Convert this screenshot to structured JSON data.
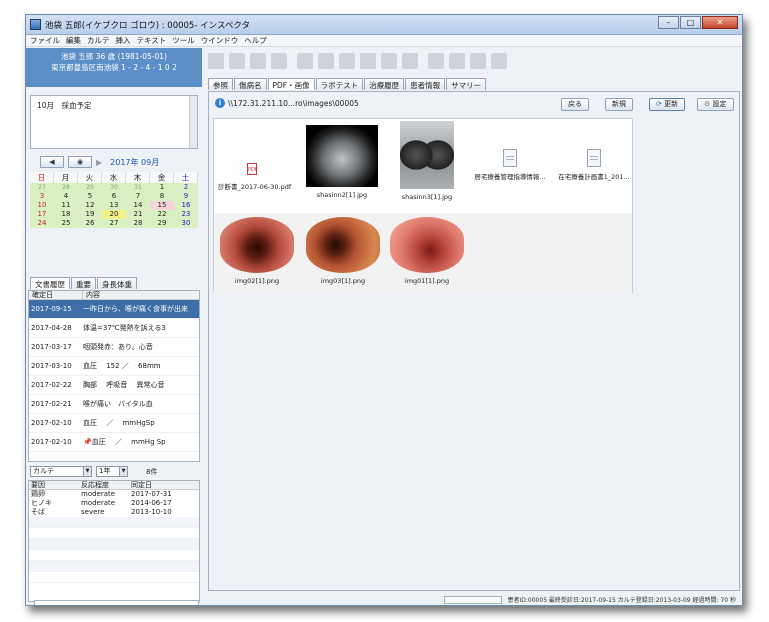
{
  "window": {
    "title": "池袋 五郎(イケブクロ ゴロウ) : 00005- インスペクタ"
  },
  "menu": [
    "ファイル",
    "編集",
    "カルテ",
    "挿入",
    "テキスト",
    "ツール",
    "ウインドウ",
    "ヘルプ"
  ],
  "patient": {
    "name_line": "池袋 五郎 36 歳 (1981-05-01)",
    "address": "東京都豊島区南池袋 1 - 2 - 4 - 1 0 2"
  },
  "memo": "10月　採血予定",
  "calendar": {
    "prev": "◀",
    "today_btn": "◉",
    "next": "▶",
    "year_month": "2017年 09月",
    "headers": [
      "日",
      "月",
      "火",
      "水",
      "木",
      "金",
      "土"
    ],
    "rows": [
      [
        "27",
        "28",
        "29",
        "30",
        "31",
        "1",
        "2"
      ],
      [
        "3",
        "4",
        "5",
        "6",
        "7",
        "8",
        "9"
      ],
      [
        "10",
        "11",
        "12",
        "13",
        "14",
        "15",
        "16"
      ],
      [
        "17",
        "18",
        "19",
        "20",
        "21",
        "22",
        "23"
      ],
      [
        "24",
        "25",
        "26",
        "27",
        "28",
        "29",
        "30"
      ]
    ]
  },
  "left_tabs": [
    "文書履歴",
    "重要",
    "身長体重"
  ],
  "history": {
    "headers": [
      "確定日",
      "内容"
    ],
    "rows": [
      {
        "date": "2017-09-15",
        "content": "一昨日から、喉が痛く食事が出来"
      },
      {
        "date": "2017-04-28",
        "content": "体温=37℃発熱を訴える3"
      },
      {
        "date": "2017-03-17",
        "content": "咽頭発赤：あり。心音"
      },
      {
        "date": "2017-03-10",
        "content": "血圧　 152 ／　 68mm"
      },
      {
        "date": "2017-02-22",
        "content": "胸部　 呼吸音　 異常心音"
      },
      {
        "date": "2017-02-21",
        "content": "喉が痛い　バイタル血"
      },
      {
        "date": "2017-02-10",
        "content": "血圧　 ／　 mmHgSp"
      },
      {
        "date": "2017-02-10",
        "content": "血圧　 ／　 mmHg Sp"
      }
    ]
  },
  "karte_ctl": {
    "type": "カルテ",
    "period": "1年",
    "count": "8件"
  },
  "allergy": {
    "headers": [
      "要因",
      "反応程度",
      "同定日"
    ],
    "rows": [
      {
        "factor": "鶏卵",
        "severity": "moderate",
        "date": "2017-07-31"
      },
      {
        "factor": "ヒノキ",
        "severity": "moderate",
        "date": "2014-06-17"
      },
      {
        "factor": "そば",
        "severity": "severe",
        "date": "2013-10-10"
      }
    ]
  },
  "main_tabs": [
    "参照",
    "傷病名",
    "PDF・画像",
    "ラボテスト",
    "治療履歴",
    "患者情報",
    "サマリー"
  ],
  "path": "\\\\172.31.211.10...ro\\images\\00005",
  "buttons": {
    "back": "戻る",
    "new": "新規",
    "refresh": "更新",
    "settings": "設定"
  },
  "gallery_items": [
    {
      "caption": "診断書_2017-06-30.pdf",
      "kind": "pdf"
    },
    {
      "caption": "shasinn2[1].jpg",
      "kind": "ct"
    },
    {
      "caption": "shasinn3[1].jpg",
      "kind": "xray"
    },
    {
      "caption": "居宅療養管理指導情報...",
      "kind": "doc"
    },
    {
      "caption": "在宅療養計画書1_201...",
      "kind": "doc"
    },
    {
      "caption": "img02[1].png",
      "kind": "endo1"
    },
    {
      "caption": "img03[1].png",
      "kind": "endo2"
    },
    {
      "caption": "img01[1].png",
      "kind": "endo3"
    }
  ],
  "status": "患者ID:00005 最終受診日:2017-09-15 カルテ登録日:2013-03-09 経過時間: 70 秒"
}
